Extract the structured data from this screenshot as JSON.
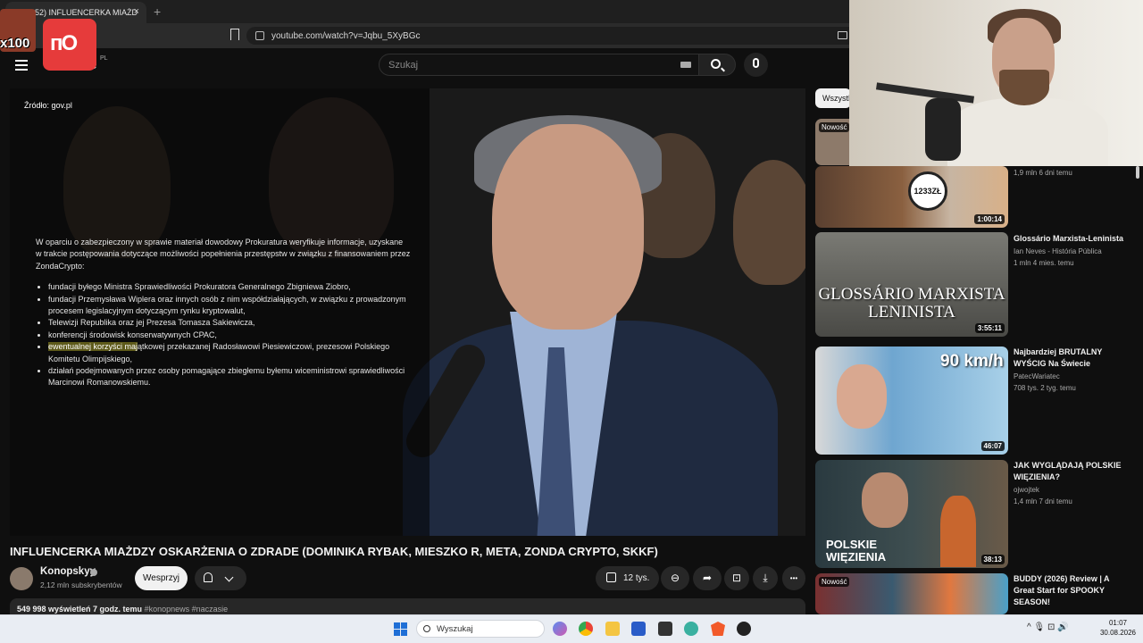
{
  "browser": {
    "tab_title": "(152) INFLUENCERKA MIAŻD",
    "tab_close": "×",
    "new_tab": "+",
    "url": "youtube.com/watch?v=Jqbu_5XyBGc"
  },
  "overlay": {
    "x100": "x100",
    "go_logo": "ᴨO"
  },
  "header": {
    "logo_tail": "e",
    "logo_region": "PL",
    "search_placeholder": "Szukaj"
  },
  "video": {
    "source_label": "Źródło: gov.pl",
    "doc_intro": "W oparciu o zabezpieczony w sprawie materiał dowodowy Prokuratura weryfikuje informacje, uzyskane w trakcie postępowania dotyczące możliwości popełnienia przestępstw w związku z finansowaniem przez ZondaCrypto:",
    "doc_items": [
      "fundacji byłego Ministra Sprawiedliwości Prokuratora Generalnego Zbigniewa Ziobro,",
      "fundacji Przemysława Wiplera oraz innych osób z nim współdziałających, w związku z prowadzonym procesem legislacyjnym dotyczącym rynku kryptowalut,",
      "Telewizji Republika oraz jej Prezesa Tomasza Sakiewicza,",
      "konferencji środowisk konserwatywnych CPAC,"
    ],
    "doc_item5_highlight": "ewentualnej korzyści maj",
    "doc_item5_rest": "ątkowej przekazanej Radosławowi Piesiewiczowi, prezesowi Polskiego Komitetu Olimpijskiego,",
    "doc_item6": "działań podejmowanych przez osoby pomagające zbiegłemu byłemu wiceministrowi sprawiedliwości Marcinowi Romanowskiemu."
  },
  "title": "INFLUENCERKA MIAŻDZY OSKARŻENIA O ZDRADE (DOMINIKA RYBAK, MIESZKO R, META, ZONDA CRYPTO, SKKF)",
  "channel": {
    "name": "Konopskyy",
    "subscribers": "2,12 mln subskrybentów",
    "support_label": "Wesprzyj"
  },
  "actions": {
    "likes": "12 tys.",
    "dislike_glyph": "⊖",
    "share_glyph": "➦",
    "save_glyph": "⊡",
    "download_glyph": "⤓",
    "more_glyph": "•••"
  },
  "description": {
    "views_time": "549 998 wyświetleń  7 godz. temu",
    "tags": "#konopnews #naczasie"
  },
  "sidebar": {
    "chip_all": "Wszystkie",
    "items": [
      {
        "badge": "Nowość",
        "duration": "",
        "title": "",
        "channel": "",
        "meta": ""
      },
      {
        "badge": "",
        "duration": "1:00:14",
        "title": "",
        "channel": "",
        "meta": "1,9 mln  6 dni temu",
        "thumb_text": "1233ZŁ"
      },
      {
        "badge": "",
        "duration": "3:55:11",
        "title": "Glossário Marxista-Leninista",
        "channel": "Ian Neves - História Pública",
        "meta": "1 mln  4 mies. temu",
        "thumb_text": "GLOSSÁRIO MARXISTA LENINISTA"
      },
      {
        "badge": "",
        "duration": "46:07",
        "title": "Najbardziej BRUTALNY WYŚCIG Na Świecie",
        "channel": "PatecWariatec",
        "meta": "708 tys.  2 tyg. temu",
        "thumb_text": "90 km/h"
      },
      {
        "badge": "",
        "duration": "38:13",
        "title": "JAK WYGLĄDAJĄ POLSKIE WIĘZIENIA?",
        "channel": "ojwojtek",
        "meta": "1,4 mln  7 dni temu",
        "thumb_text": "POLSKIE WIĘZIENIA"
      },
      {
        "badge": "Nowość",
        "duration": "",
        "title": "BUDDY (2026) Review | A Great Start for SPOOKY SEASON!",
        "channel": "",
        "meta": ""
      }
    ]
  },
  "taskbar": {
    "search_label": "Wyszukaj",
    "tray": "^  🎙  ⊡  🔊",
    "time": "01:07",
    "date": "30.08.2026"
  },
  "colors": {
    "bg": "#0f0f0f",
    "accent_red": "#ff0000",
    "highlight": "#5e5a1a"
  }
}
